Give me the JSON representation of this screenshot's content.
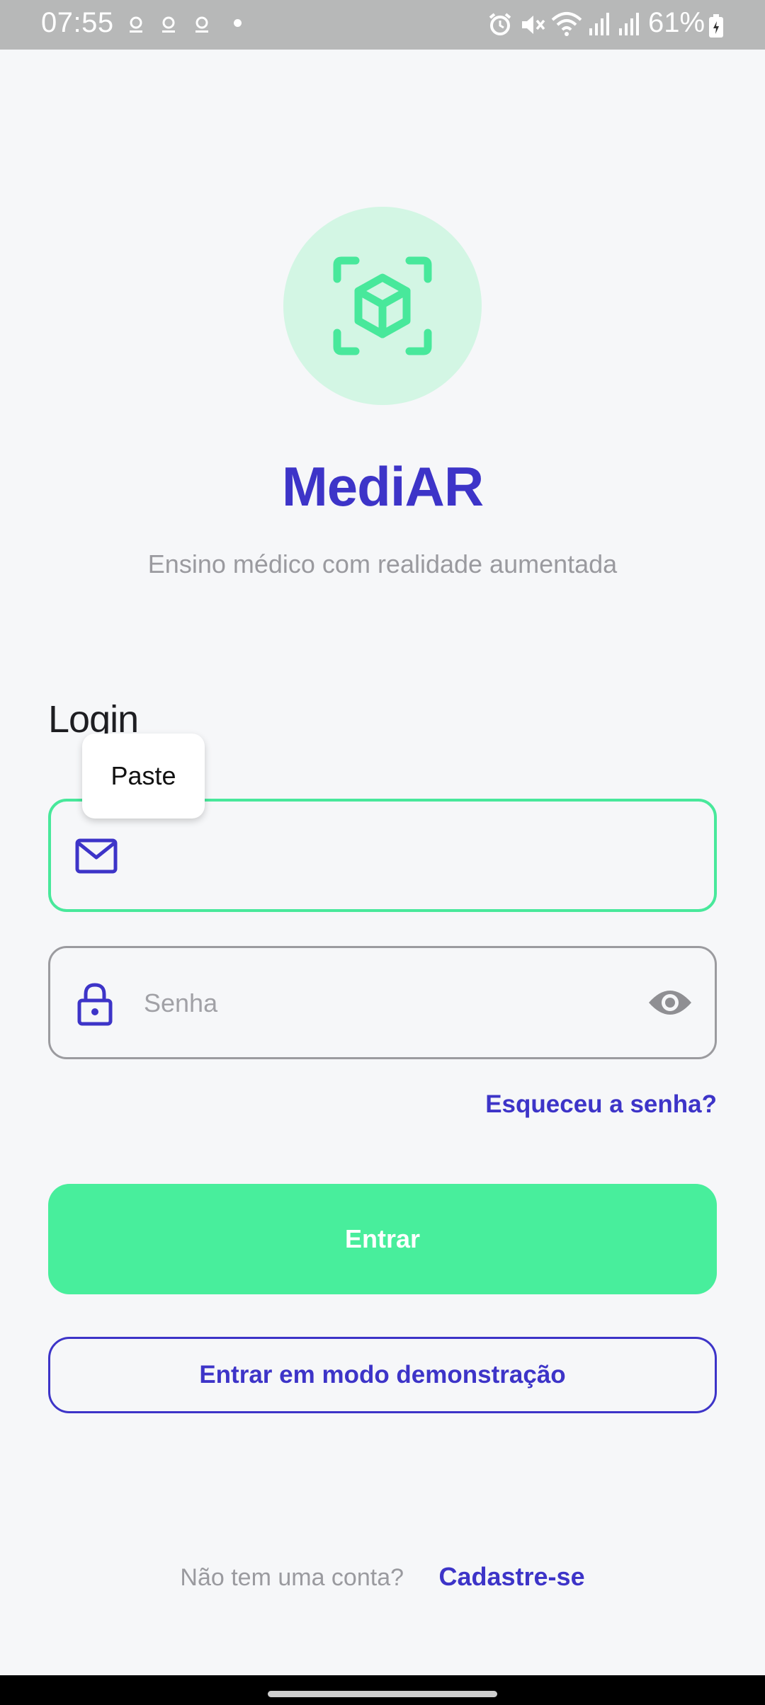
{
  "status_bar": {
    "time": "07:55",
    "battery_percent": "61%",
    "icons": [
      "notification-icon",
      "notification-icon",
      "notification-icon",
      "dot-icon",
      "alarm-icon",
      "mute-icon",
      "wifi-icon",
      "signal-icon",
      "signal-icon",
      "battery-icon"
    ]
  },
  "app": {
    "logo_icon": "ar-cube-icon",
    "title": "MediAR",
    "subtitle": "Ensino médico com realidade aumentada"
  },
  "login": {
    "heading": "Login",
    "email": {
      "value": "",
      "placeholder": "",
      "icon": "mail-icon"
    },
    "password": {
      "value": "",
      "placeholder": "Senha",
      "icon": "lock-icon",
      "toggle_icon": "eye-icon"
    },
    "paste_label": "Paste",
    "forgot_label": "Esqueceu a senha?",
    "submit_label": "Entrar",
    "demo_label": "Entrar em modo demonstração",
    "signup_question": "Não tem uma conta?",
    "signup_label": "Cadastre-se"
  },
  "colors": {
    "primary": "#3d34c8",
    "accent": "#48ee9c",
    "accent_light": "#d3f6e4",
    "background": "#f6f7f9"
  }
}
